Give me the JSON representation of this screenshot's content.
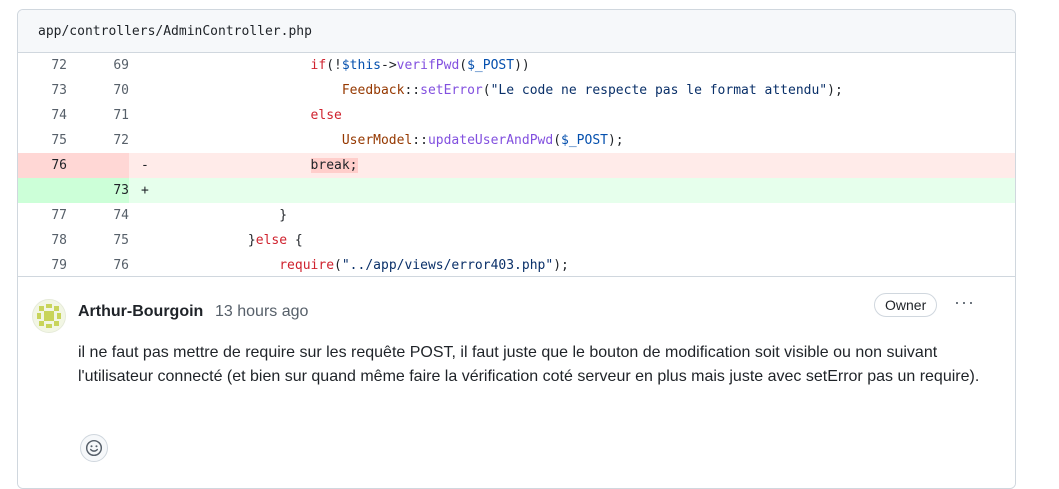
{
  "file": {
    "path": "app/controllers/AdminController.php"
  },
  "diff": {
    "rows": [
      {
        "old": "72",
        "new": "69",
        "marker": "",
        "type": "ctx"
      },
      {
        "old": "73",
        "new": "70",
        "marker": "",
        "type": "ctx"
      },
      {
        "old": "74",
        "new": "71",
        "marker": "",
        "type": "ctx"
      },
      {
        "old": "75",
        "new": "72",
        "marker": "",
        "type": "ctx"
      },
      {
        "old": "76",
        "new": "",
        "marker": "-",
        "type": "del"
      },
      {
        "old": "",
        "new": "73",
        "marker": "+",
        "type": "add"
      },
      {
        "old": "77",
        "new": "74",
        "marker": "",
        "type": "ctx"
      },
      {
        "old": "78",
        "new": "75",
        "marker": "",
        "type": "ctx"
      },
      {
        "old": "79",
        "new": "76",
        "marker": "",
        "type": "ctx"
      }
    ],
    "code": {
      "l1": {
        "indent": "                    ",
        "kw_if": "if",
        "p1": "(!",
        "this": "$this",
        "arrow": "->",
        "fn": "verifPwd",
        "p2": "(",
        "post": "$_POST",
        "p3": "))"
      },
      "l2": {
        "indent": "                        ",
        "cls": "Feedback",
        "sep": "::",
        "fn": "setError",
        "p1": "(",
        "str": "\"Le code ne respecte pas le format attendu\"",
        "p2": ");"
      },
      "l3": {
        "indent": "                    ",
        "kw": "else"
      },
      "l4": {
        "indent": "                        ",
        "cls": "UserModel",
        "sep": "::",
        "fn": "updateUserAndPwd",
        "p1": "(",
        "post": "$_POST",
        "p2": ");"
      },
      "l5": {
        "indent": "                    ",
        "text": "break;"
      },
      "l6": {
        "text": ""
      },
      "l7": {
        "indent": "                ",
        "text": "}"
      },
      "l8": {
        "indent": "            ",
        "text": "}",
        "kw": "else",
        "rest": " {"
      },
      "l9": {
        "indent": "                ",
        "kw": "require",
        "p1": "(",
        "str": "\"../app/views/error403.php\"",
        "p2": ");"
      }
    }
  },
  "comment": {
    "author": "Arthur-Bourgoin",
    "time": "13 hours ago",
    "badge": "Owner",
    "menu": "···",
    "body": "il ne faut pas mettre de require sur les requête POST, il faut juste que le bouton de modification soit visible ou non suivant l'utilisateur connecté (et bien sur quand même faire la vérification coté serveur en plus mais juste avec setError pas un require).",
    "avatar_icon": "identicon-avatar",
    "reaction_icon": "smiley-icon"
  },
  "colors": {
    "del_bg": "#ffebe9",
    "add_bg": "#e6ffec",
    "keyword": "#cf222e",
    "function": "#8250df"
  }
}
